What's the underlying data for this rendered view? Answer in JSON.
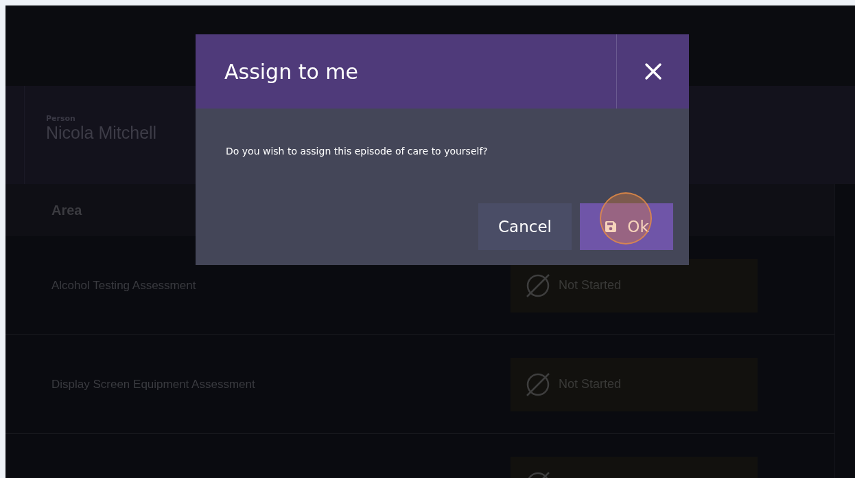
{
  "person": {
    "label": "Person",
    "name": "Nicola Mitchell"
  },
  "table": {
    "columns": [
      "Area"
    ],
    "rows": [
      {
        "area": "Alcohol Testing Assessment",
        "status": "Not Started"
      },
      {
        "area": "Display Screen Equipment Assessment",
        "status": "Not Started"
      },
      {}
    ]
  },
  "dialog": {
    "title": "Assign to me",
    "message": "Do you wish to assign this episode of care to yourself?",
    "buttons": [
      {
        "label": "Cancel",
        "kind": "secondary"
      },
      {
        "label": "Ok",
        "kind": "primary"
      }
    ]
  }
}
